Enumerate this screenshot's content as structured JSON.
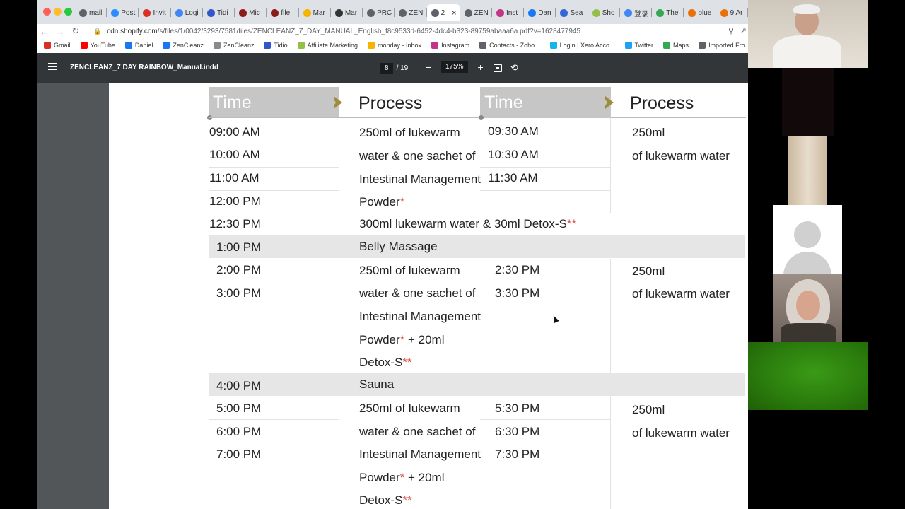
{
  "browser": {
    "tabs": [
      {
        "label": "mail",
        "icon": "globe-icon",
        "color": "#5f6368"
      },
      {
        "label": "Post",
        "icon": "zoom-icon",
        "color": "#2d8cff"
      },
      {
        "label": "Invit",
        "icon": "gmail-icon",
        "color": "#d93025"
      },
      {
        "label": "Logi",
        "icon": "globe-icon",
        "color": "#4285f4"
      },
      {
        "label": "Tidi",
        "icon": "tidio-icon",
        "color": "#3355cc"
      },
      {
        "label": "Mic",
        "icon": "t-icon",
        "color": "#8b1a1a"
      },
      {
        "label": "file",
        "icon": "t-icon",
        "color": "#8b1a1a"
      },
      {
        "label": "Mar",
        "icon": "drive-icon",
        "color": "#f4b400"
      },
      {
        "label": "Mar",
        "icon": "github-icon",
        "color": "#333333"
      },
      {
        "label": "PRC",
        "icon": "globe-icon",
        "color": "#5f6368"
      },
      {
        "label": "ZEN",
        "icon": "globe-icon",
        "color": "#5f6368"
      },
      {
        "label": "2",
        "icon": "globe-icon",
        "color": "#5f6368",
        "active": true
      },
      {
        "label": "ZEN",
        "icon": "globe-icon",
        "color": "#5f6368"
      },
      {
        "label": "Inst",
        "icon": "instagram-icon",
        "color": "#c13584"
      },
      {
        "label": "Dan",
        "icon": "facebook-icon",
        "color": "#1877f2"
      },
      {
        "label": "Sea",
        "icon": "shield-icon",
        "color": "#3367d6"
      },
      {
        "label": "Sho",
        "icon": "shopify-icon",
        "color": "#95bf47"
      },
      {
        "label": "登录",
        "icon": "google-icon",
        "color": "#4285f4"
      },
      {
        "label": "The",
        "icon": "globe-icon",
        "color": "#34a853"
      },
      {
        "label": "blue",
        "icon": "globe-icon",
        "color": "#e8710a"
      },
      {
        "label": "9 Ar",
        "icon": "figure-icon",
        "color": "#e8710a"
      }
    ],
    "url_host": "cdn.shopify.com",
    "url_path": "/s/files/1/0042/3293/7581/files/ZENCLEANZ_7_DAY_MANUAL_English_f8c9533d-6452-4dc4-b323-89759abaaa6a.pdf?v=1628477945",
    "bookmarks": [
      {
        "label": "Gmail",
        "icon": "gmail-icon",
        "color": "#d93025"
      },
      {
        "label": "YouTube",
        "icon": "youtube-icon",
        "color": "#ff0000"
      },
      {
        "label": "Daniel",
        "icon": "facebook-icon",
        "color": "#1877f2"
      },
      {
        "label": "ZenCleanz",
        "icon": "facebook-icon",
        "color": "#1877f2"
      },
      {
        "label": "ZenCleanz",
        "icon": "leaf-icon",
        "color": "#8a8a8a"
      },
      {
        "label": "Tidio",
        "icon": "tidio-icon",
        "color": "#3355cc"
      },
      {
        "label": "Affiliate Marketing",
        "icon": "shopify-icon",
        "color": "#95bf47"
      },
      {
        "label": "monday - Inbox",
        "icon": "monday-icon",
        "color": "#f4b400"
      },
      {
        "label": "Instagram",
        "icon": "instagram-icon",
        "color": "#c13584"
      },
      {
        "label": "Contacts - Zoho...",
        "icon": "zoho-icon",
        "color": "#5f6368"
      },
      {
        "label": "Login | Xero Acco...",
        "icon": "xero-icon",
        "color": "#13b5ea"
      },
      {
        "label": "Twitter",
        "icon": "twitter-icon",
        "color": "#1da1f2"
      },
      {
        "label": "Maps",
        "icon": "maps-icon",
        "color": "#34a853"
      },
      {
        "label": "Imported Fro",
        "icon": "folder-icon",
        "color": "#5f6368"
      }
    ]
  },
  "pdf": {
    "title": "ZENCLEANZ_7 DAY RAINBOW_Manual.indd",
    "page_current": "8",
    "page_total": "/ 19",
    "zoom": "175%",
    "header": {
      "time": "Time",
      "process": "Process"
    },
    "rows": [
      {
        "time": "09:00 AM",
        "process": "250ml of lukewarm",
        "time2": "09:30 AM",
        "process2": "250ml"
      },
      {
        "time": "10:00 AM",
        "process": "water & one sachet of",
        "time2": "10:30 AM",
        "process2": "of lukewarm water"
      },
      {
        "time": "11:00 AM",
        "process": "Intestinal Management",
        "time2": "11:30 AM",
        "process2": ""
      },
      {
        "time": "12:00 PM",
        "process": "Powder",
        "mark": "*",
        "time2": "",
        "process2": ""
      },
      {
        "time": "12:30 PM",
        "process": "300ml lukewarm water & 30ml Detox-S",
        "mark": "**"
      },
      {
        "time": "1:00 PM",
        "process": "Belly Massage"
      },
      {
        "time": "2:00 PM",
        "process": "250ml of lukewarm",
        "time2": "2:30 PM",
        "process2": "250ml"
      },
      {
        "time": "3:00 PM",
        "process": "water & one sachet of",
        "time2": "3:30 PM",
        "process2": "of lukewarm water"
      },
      {
        "time": "",
        "process": "Intestinal Management"
      },
      {
        "time": "",
        "process": "Powder",
        "mark": "*",
        "suffix": " + 20ml"
      },
      {
        "time": "",
        "process": "Detox-S",
        "mark": "**"
      },
      {
        "time": "4:00 PM",
        "process": "Sauna"
      },
      {
        "time": "5:00 PM",
        "process": "250ml of lukewarm",
        "time2": "5:30 PM",
        "process2": "250ml"
      },
      {
        "time": "6:00 PM",
        "process": "water & one sachet of",
        "time2": "6:30 PM",
        "process2": "of lukewarm water"
      },
      {
        "time": "7:00 PM",
        "process": "Intestinal Management",
        "time2": "7:30 PM",
        "process2": ""
      },
      {
        "time": "",
        "process": "Powder",
        "mark": "*",
        "suffix": " + 20ml"
      },
      {
        "time": "",
        "process": "Detox-S",
        "mark": "**"
      }
    ]
  },
  "video": {
    "participants": [
      {
        "name": "host-participant"
      },
      {
        "name": "dark-tile"
      },
      {
        "name": "door-tile"
      },
      {
        "name": "no-video-participant"
      },
      {
        "name": "woman-participant"
      },
      {
        "name": "green-tile"
      }
    ]
  },
  "colors": {
    "pdf_toolbar": "#323639",
    "pdf_bg": "#525659",
    "header_gray": "#c6c6c6",
    "chevron": "#a08b3a",
    "asterisk": "#d9534f"
  }
}
